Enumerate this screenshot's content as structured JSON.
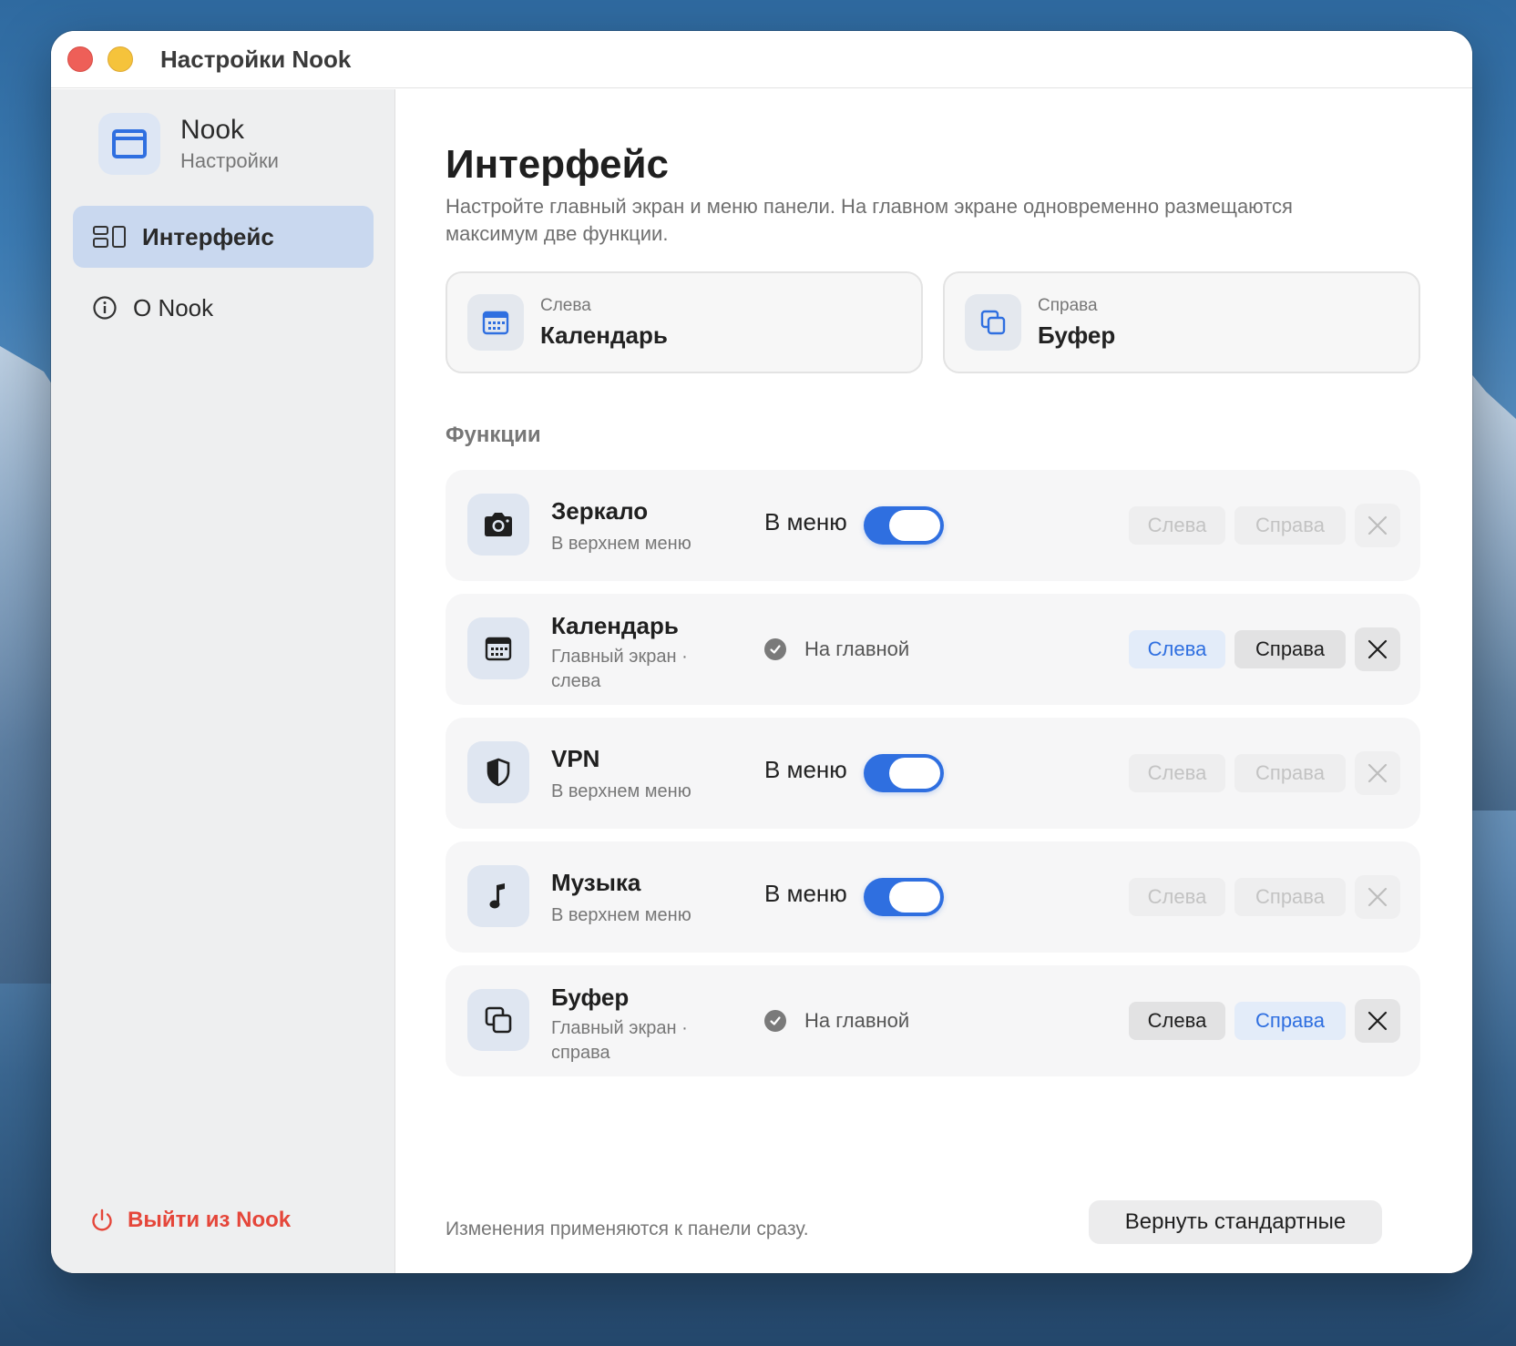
{
  "window": {
    "title": "Настройки Nook"
  },
  "sidebar": {
    "app_name": "Nook",
    "app_subtitle": "Настройки",
    "items": [
      {
        "label": "Интерфейс",
        "icon": "layout-icon",
        "active": true
      },
      {
        "label": "O Nook",
        "icon": "info-icon",
        "active": false
      }
    ],
    "logout_label": "Выйти из Nook"
  },
  "main": {
    "title": "Интерфейс",
    "description": "Настройте главный экран и меню панели. На главном экране одновременно размещаются максимум две функции.",
    "slots": [
      {
        "caption": "Слева",
        "value": "Календарь",
        "icon": "calendar-icon"
      },
      {
        "caption": "Справа",
        "value": "Буфер",
        "icon": "clipboard-icon"
      }
    ],
    "section_title": "Функции",
    "features": [
      {
        "name": "Зеркало",
        "sub": "В верхнем меню",
        "icon": "camera-icon",
        "mode": "menu",
        "state_label": "В меню",
        "toggle_on": true,
        "left_label": "Слева",
        "right_label": "Справа"
      },
      {
        "name": "Календарь",
        "sub": "Главный экран · слева",
        "icon": "calendar-icon",
        "mode": "home",
        "state_label": "На главной",
        "left_label": "Слева",
        "right_label": "Справа",
        "selected": "left"
      },
      {
        "name": "VPN",
        "sub": "В верхнем меню",
        "icon": "shield-icon",
        "mode": "menu",
        "state_label": "В меню",
        "toggle_on": true,
        "left_label": "Слева",
        "right_label": "Справа"
      },
      {
        "name": "Музыка",
        "sub": "В верхнем меню",
        "icon": "music-note-icon",
        "mode": "menu",
        "state_label": "В меню",
        "toggle_on": true,
        "left_label": "Слева",
        "right_label": "Справа"
      },
      {
        "name": "Буфер",
        "sub": "Главный экран · справа",
        "icon": "clipboard-icon",
        "mode": "home",
        "state_label": "На главной",
        "left_label": "Слева",
        "right_label": "Справа",
        "selected": "right"
      }
    ],
    "footer_note": "Изменения применяются к панели сразу.",
    "reset_label": "Вернуть стандартные"
  },
  "colors": {
    "accent": "#2f6fe0",
    "danger": "#e5463a",
    "sidebar_active": "#c9d8ef"
  }
}
